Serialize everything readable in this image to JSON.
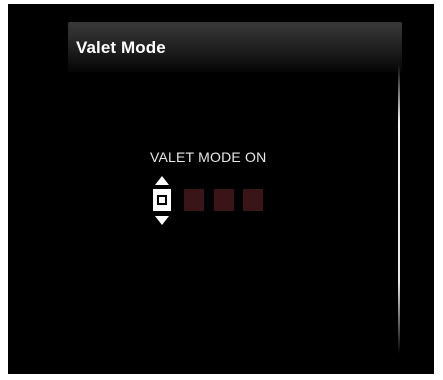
{
  "header": {
    "title": "Valet Mode"
  },
  "status": {
    "text": "VALET MODE ON"
  },
  "pin_entry": {
    "digit_count": 4,
    "active_index": 0,
    "slot_color": "#3a1518",
    "active_color": "#ffffff"
  },
  "icons": {
    "up": "chevron-up-icon",
    "down": "chevron-down-icon"
  }
}
